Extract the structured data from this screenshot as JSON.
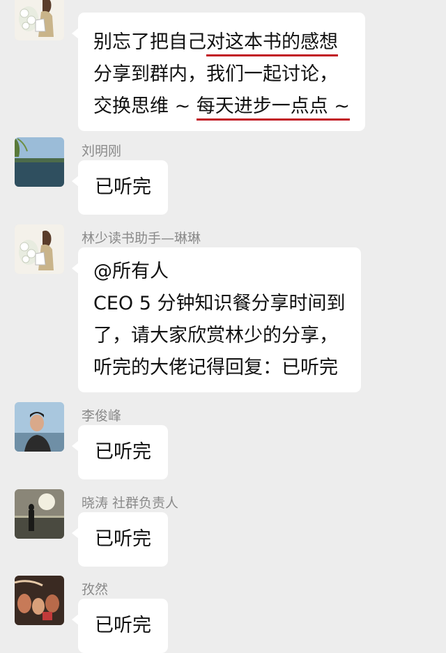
{
  "messages": [
    {
      "sender": "",
      "avatar": "woman-flowers-avatar",
      "lines": [
        {
          "before": "别忘了把自己",
          "highlight": "对这本书的感想",
          "after": ""
        },
        {
          "before": "分享到群内，我们一起讨论，",
          "highlight": "",
          "after": ""
        },
        {
          "before": "交换思维 ~ ",
          "highlight": "每天进步一点点 ~",
          "after": ""
        }
      ]
    },
    {
      "sender": "刘明刚",
      "avatar": "lake-landscape-avatar",
      "lines": [
        {
          "before": "已听完",
          "highlight": "",
          "after": ""
        }
      ]
    },
    {
      "sender": "林少读书助手—琳琳",
      "avatar": "woman-flowers-avatar",
      "lines": [
        {
          "before": "@所有人",
          "highlight": "",
          "after": ""
        },
        {
          "before": "CEO 5 分钟知识餐分享时间到",
          "highlight": "",
          "after": ""
        },
        {
          "before": "了，请大家欣赏林少的分享，",
          "highlight": "",
          "after": ""
        },
        {
          "before": "听完的大佬记得回复：已听完",
          "highlight": "",
          "after": ""
        }
      ]
    },
    {
      "sender": "李俊峰",
      "avatar": "man-portrait-avatar",
      "lines": [
        {
          "before": "已听完",
          "highlight": "",
          "after": ""
        }
      ]
    },
    {
      "sender": "晓涛 社群负责人",
      "avatar": "sunset-silhouette-avatar",
      "lines": [
        {
          "before": "已听完",
          "highlight": "",
          "after": ""
        }
      ]
    },
    {
      "sender": "孜然",
      "avatar": "group-photo-avatar",
      "lines": [
        {
          "before": "已听完",
          "highlight": "",
          "after": ""
        }
      ]
    }
  ],
  "colors": {
    "background": "#ededed",
    "bubble": "#ffffff",
    "underline": "#c1121f",
    "sender_text": "#8a8a8a"
  }
}
